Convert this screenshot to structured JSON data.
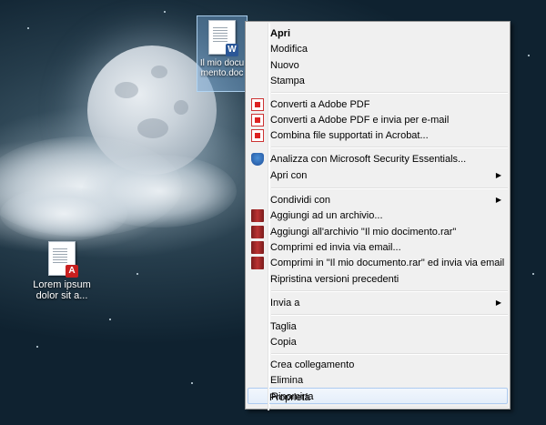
{
  "desktop": {
    "icons": [
      {
        "label": "Il mio documento.doc",
        "badge": "W",
        "badge_color": "#2b5797"
      },
      {
        "label": "Lorem ipsum dolor sit a...",
        "badge": "A",
        "badge_color": "#c81f1f"
      }
    ]
  },
  "context_menu": {
    "items": [
      {
        "label": "Apri",
        "bold": true
      },
      {
        "label": "Modifica"
      },
      {
        "label": "Nuovo"
      },
      {
        "label": "Stampa"
      },
      {
        "label": "Converti a Adobe PDF",
        "icon": "adobe-pdf-icon"
      },
      {
        "label": "Converti a Adobe PDF e invia per e-mail",
        "icon": "adobe-pdf-email-icon"
      },
      {
        "label": "Combina file supportati in Acrobat...",
        "icon": "acrobat-combine-icon"
      },
      {
        "label": "Analizza con Microsoft Security Essentials...",
        "icon": "security-essentials-icon"
      },
      {
        "label": "Apri con",
        "submenu": true
      },
      {
        "label": "Condividi con",
        "submenu": true
      },
      {
        "label": "Aggiungi ad un archivio...",
        "icon": "winrar-icon"
      },
      {
        "label": "Aggiungi all'archivio \"Il mio docimento.rar\"",
        "icon": "winrar-icon"
      },
      {
        "label": "Comprimi ed invia via email...",
        "icon": "winrar-icon"
      },
      {
        "label": "Comprimi in \"Il mio documento.rar\" ed invia via email",
        "icon": "winrar-icon"
      },
      {
        "label": "Ripristina versioni precedenti"
      },
      {
        "label": "Invia a",
        "submenu": true
      },
      {
        "label": "Taglia"
      },
      {
        "label": "Copia"
      },
      {
        "label": "Crea collegamento"
      },
      {
        "label": "Elimina"
      },
      {
        "label": "Rinomina",
        "highlighted": true
      },
      {
        "label": "Proprietà"
      }
    ]
  }
}
